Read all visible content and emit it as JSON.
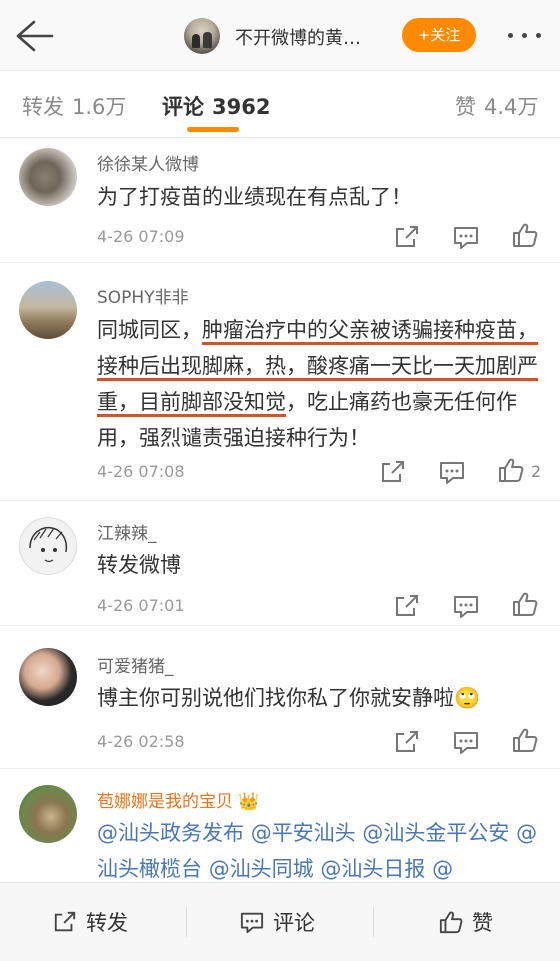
{
  "header": {
    "title": "不开微博的黄…",
    "follow_label": "+关注"
  },
  "tabs": [
    {
      "label": "转发",
      "count": "1.6万"
    },
    {
      "label": "评论",
      "count": "3962"
    },
    {
      "label": "赞",
      "count": "4.4万"
    }
  ],
  "comments": [
    {
      "user": "徐徐某人微博",
      "text": "为了打疫苗的业绩现在有点乱了！",
      "time": "4-26 07:09",
      "likes": ""
    },
    {
      "user": "SOPHY非非",
      "text_a": "同城同区，",
      "text_b": "肿瘤治疗中的父亲被诱骗接种疫苗，接种后出现脚麻，热，酸疼痛一天比一天加剧严重，目前脚部没知觉",
      "text_c": "，吃止痛药也豪无任何作用，强烈谴责强迫接种行为！",
      "time": "4-26 07:08",
      "likes": "2"
    },
    {
      "user": "江辣辣_",
      "text": "转发微博",
      "time": "4-26 07:01",
      "likes": ""
    },
    {
      "user": "可爱猪猪_",
      "text": "博主你可别说他们找你私了你就安静啦",
      "emoji": "🙄",
      "time": "4-26 02:58",
      "likes": ""
    },
    {
      "user": "苞娜娜是我的宝贝",
      "mentions": [
        "@汕头政务发布",
        "@平安汕头",
        "@汕头金平公安",
        "@汕头橄榄台",
        "@汕头同城",
        "@汕头日报",
        "@"
      ]
    }
  ],
  "bottombar": {
    "repost": "转发",
    "comment": "评论",
    "like": "赞"
  }
}
